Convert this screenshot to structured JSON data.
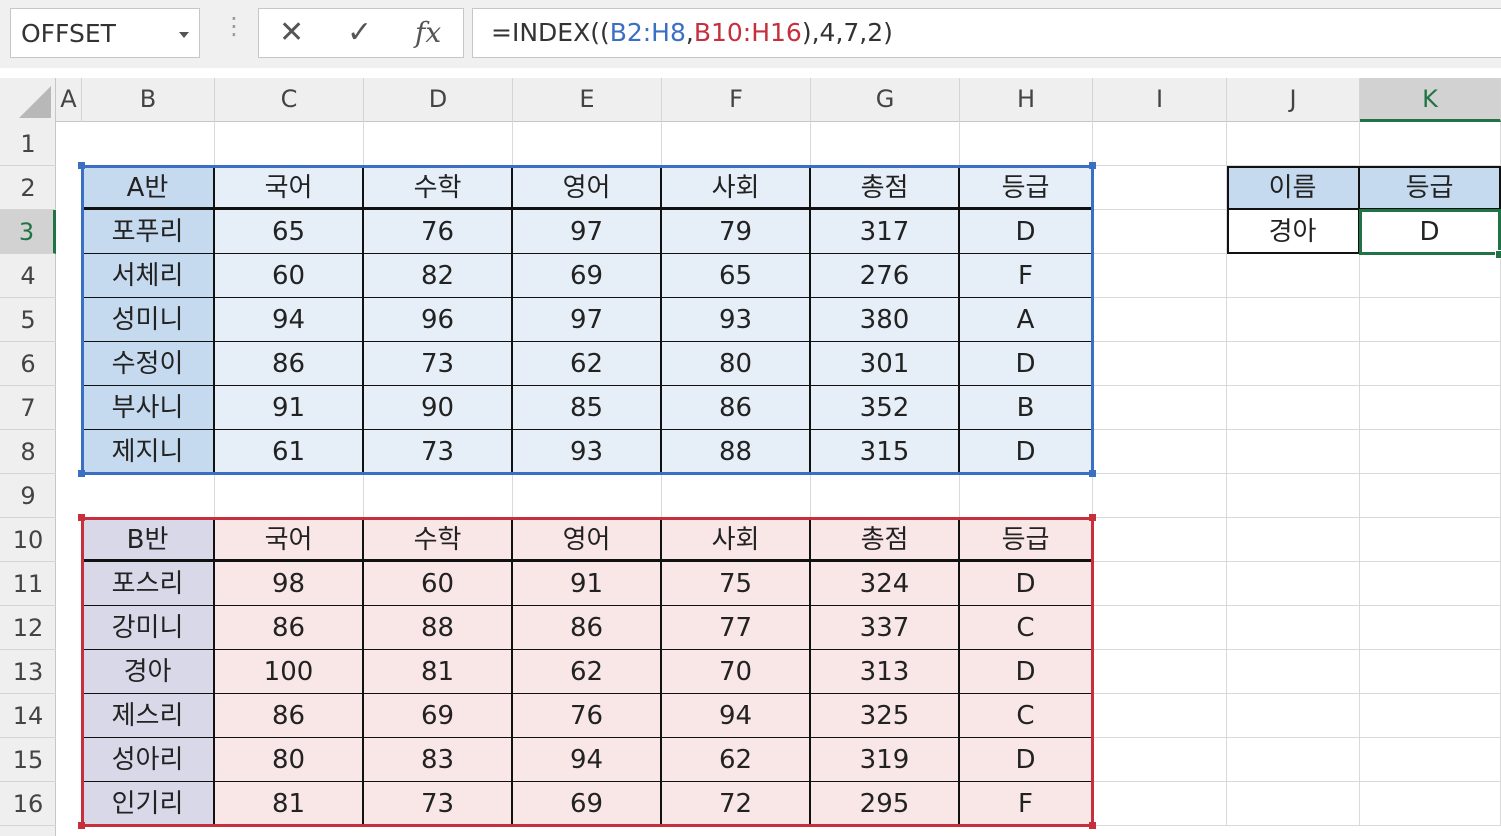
{
  "name_box": {
    "value": "OFFSET"
  },
  "formula_bar": {
    "cancel_icon": "✕",
    "enter_icon": "✓",
    "fx_label": "fx",
    "formula_prefix": "=INDEX((",
    "ref1": "B2:H8",
    "sep": ",",
    "ref2": "B10:H16",
    "formula_suffix": "),4,7,2)"
  },
  "columns": [
    "A",
    "B",
    "C",
    "D",
    "E",
    "F",
    "G",
    "H",
    "I",
    "J",
    "K"
  ],
  "selected_column": "K",
  "rows": [
    "1",
    "2",
    "3",
    "4",
    "5",
    "6",
    "7",
    "8",
    "9",
    "10",
    "11",
    "12",
    "13",
    "14",
    "15",
    "16"
  ],
  "selected_row": "3",
  "colors": {
    "a_header_fill": "#c5d9ef",
    "a_body_fill": "#e6eef8",
    "a_border": "#3b6fc4",
    "b_header_fill": "#d8d8e8",
    "b_body_fill": "#f9e6e6",
    "b_border": "#c5303c",
    "selection": "#217346"
  },
  "table_a": {
    "header": [
      "A반",
      "국어",
      "수학",
      "영어",
      "사회",
      "총점",
      "등급"
    ],
    "rows": [
      [
        "포푸리",
        "65",
        "76",
        "97",
        "79",
        "317",
        "D"
      ],
      [
        "서체리",
        "60",
        "82",
        "69",
        "65",
        "276",
        "F"
      ],
      [
        "성미니",
        "94",
        "96",
        "97",
        "93",
        "380",
        "A"
      ],
      [
        "수정이",
        "86",
        "73",
        "62",
        "80",
        "301",
        "D"
      ],
      [
        "부사니",
        "91",
        "90",
        "85",
        "86",
        "352",
        "B"
      ],
      [
        "제지니",
        "61",
        "73",
        "93",
        "88",
        "315",
        "D"
      ]
    ]
  },
  "table_b": {
    "header": [
      "B반",
      "국어",
      "수학",
      "영어",
      "사회",
      "총점",
      "등급"
    ],
    "rows": [
      [
        "포스리",
        "98",
        "60",
        "91",
        "75",
        "324",
        "D"
      ],
      [
        "강미니",
        "86",
        "88",
        "86",
        "77",
        "337",
        "C"
      ],
      [
        "경아",
        "100",
        "81",
        "62",
        "70",
        "313",
        "D"
      ],
      [
        "제스리",
        "86",
        "69",
        "76",
        "94",
        "325",
        "C"
      ],
      [
        "성아리",
        "80",
        "83",
        "94",
        "62",
        "319",
        "D"
      ],
      [
        "인기리",
        "81",
        "73",
        "69",
        "72",
        "295",
        "F"
      ]
    ]
  },
  "lookup": {
    "header": [
      "이름",
      "등급"
    ],
    "values": [
      "경아",
      "D"
    ]
  }
}
